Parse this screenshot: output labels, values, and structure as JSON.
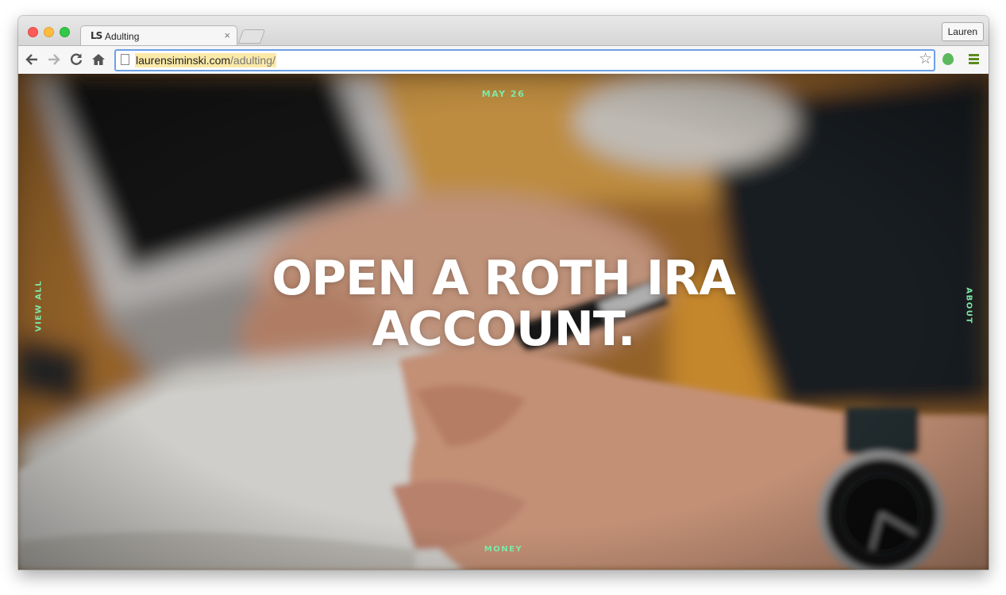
{
  "browser": {
    "tab_title": "Adulting",
    "tab_favicon_text": "LS",
    "tab_close": "×",
    "profile_label": "Lauren",
    "url_domain": "laurensiminski.com",
    "url_path": "/adulting/",
    "icons": [
      "back-arrow-icon",
      "forward-arrow-icon",
      "reload-icon",
      "home-icon",
      "page-icon",
      "star-icon",
      "evernote-icon",
      "menu-icon"
    ]
  },
  "page": {
    "date": "MAY 26",
    "headline_line1": "OPEN A ROTH IRA",
    "headline_line2": "ACCOUNT.",
    "left_link": "VIEW ALL",
    "right_link": "ABOUT",
    "category": "MONEY",
    "accent_color": "#7de8a6"
  }
}
